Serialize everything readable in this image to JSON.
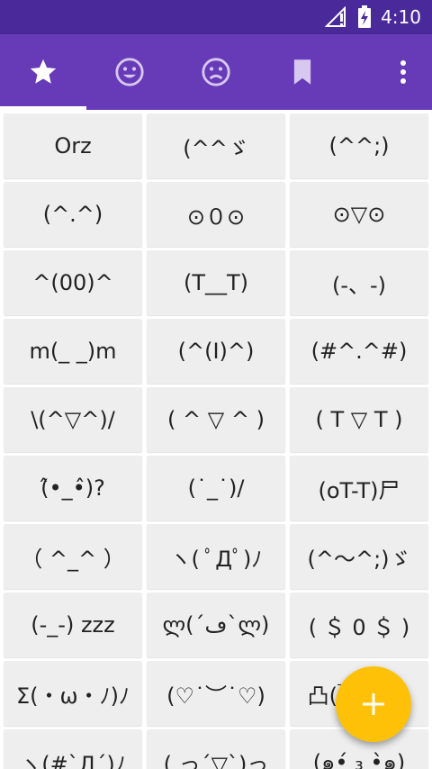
{
  "status_bar": {
    "time": "4:10",
    "icons": [
      "signal-icon",
      "battery-icon"
    ]
  },
  "tabs": [
    {
      "icon": "star-icon",
      "selected": true
    },
    {
      "icon": "smiley-icon",
      "selected": false
    },
    {
      "icon": "sad-face-icon",
      "selected": false
    },
    {
      "icon": "bookmark-icon",
      "selected": false
    }
  ],
  "overflow_menu_icon": "more-vert-icon",
  "colors": {
    "status_bar": "#4a2a9a",
    "app_bar": "#673ab7",
    "fab": "#ffc107",
    "cell_background": "#eeeeee"
  },
  "emoticons": [
    [
      "Orz",
      "(^^ゞ",
      "(^^;)"
    ],
    [
      "(^.^)",
      "⊙０⊙",
      "⊙▽⊙"
    ],
    [
      "^(00)^",
      "(T__T)",
      "(-、-)"
    ],
    [
      "m(_ _)m",
      "(^(I)^)",
      "(#^.^#)"
    ],
    [
      "\\(^▽^)/",
      "( ^ ▽ ^ )",
      "( T ▽ T )"
    ],
    [
      "(̂•_•̂)?",
      "(˙_˙)/",
      "(oT-T)尸"
    ],
    [
      "（ ^_^ ）",
      "ヽ( ﾟДﾟ)ﾉ",
      "(^～^;)ゞ"
    ],
    [
      "(-_-) zzz",
      "ლ(´ڡ`ლ)",
      "( ＄ 0 ＄ )"
    ],
    [
      "Σ(・ω・ﾉ)ﾉ",
      "(♡˙︶˙♡)",
      "凸(￣ヘ￣)"
    ],
    [
      "ヽ(#`Д´)ﾉ",
      "( っ´▽`)っ",
      "(๑•́ ₃ •̀๑)"
    ]
  ],
  "fab": {
    "label": "+",
    "icon": "add-icon"
  }
}
